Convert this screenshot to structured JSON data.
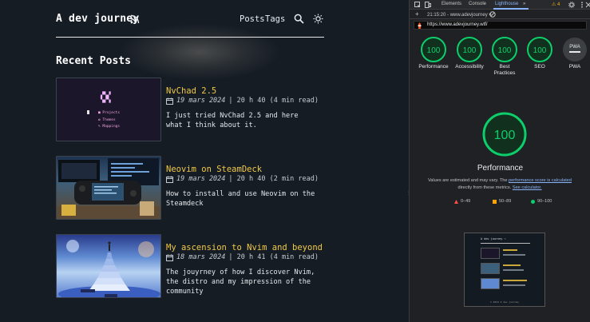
{
  "blog": {
    "site_title": "A dev journey",
    "nav": {
      "posts": "Posts",
      "tags": "Tags"
    },
    "section_title": "Recent Posts",
    "posts": [
      {
        "title": "NvChad 2.5",
        "date": "19 mars 2024",
        "meta_rest": "| 20 h 40 (4 min read)",
        "desc": "I just tried NvChad 2.5 and here what I think about it.",
        "thumb_menu": [
          "■ Projects",
          "✿ Themes",
          "✎ Mappings"
        ]
      },
      {
        "title": "Neovim on SteamDeck",
        "date": "19 mars 2024",
        "meta_rest": "| 20 h 40 (2 min read)",
        "desc": "How to install and use Neovim on the Steamdeck"
      },
      {
        "title": "My ascension to Nvim and beyond",
        "date": "18 mars 2024",
        "meta_rest": "| 20 h 41 (4 min read)",
        "desc": "The jouyrney of how I discover Nvim, the distro and my impression of the community"
      }
    ]
  },
  "devtools": {
    "tabs": [
      "Elements",
      "Console",
      "Lighthouse"
    ],
    "active_tab": "Lighthouse",
    "more": "»",
    "warning_count": "4",
    "report_label": "21:15:20 - www.adevjourney ▾",
    "add": "+",
    "url": "https://www.adevjourney.wtf/",
    "scores": [
      {
        "label": "Performance",
        "value": "100"
      },
      {
        "label": "Accessibility",
        "value": "100"
      },
      {
        "label": "Best Practices",
        "value": "100"
      },
      {
        "label": "SEO",
        "value": "100"
      },
      {
        "label": "PWA",
        "value": "PWA"
      }
    ],
    "big_score": "100",
    "perf_title": "Performance",
    "note_1": "Values are estimated and may vary. The ",
    "note_link_1": "performance score is calculated",
    "note_2": " directly from these metrics. ",
    "note_link_2": "See calculator.",
    "legend": [
      {
        "label": "0–49",
        "color": "#ff4e42"
      },
      {
        "label": "50–89",
        "color": "#ffa400"
      },
      {
        "label": "90–100",
        "color": "#0cce6b"
      }
    ],
    "mini_title": "A dev journey ⌁",
    "mini_footer": "© 2024 A dev journey"
  },
  "colors": {
    "accent": "#f0c948",
    "pass": "#0cce6b",
    "link": "#8ab4f8"
  }
}
